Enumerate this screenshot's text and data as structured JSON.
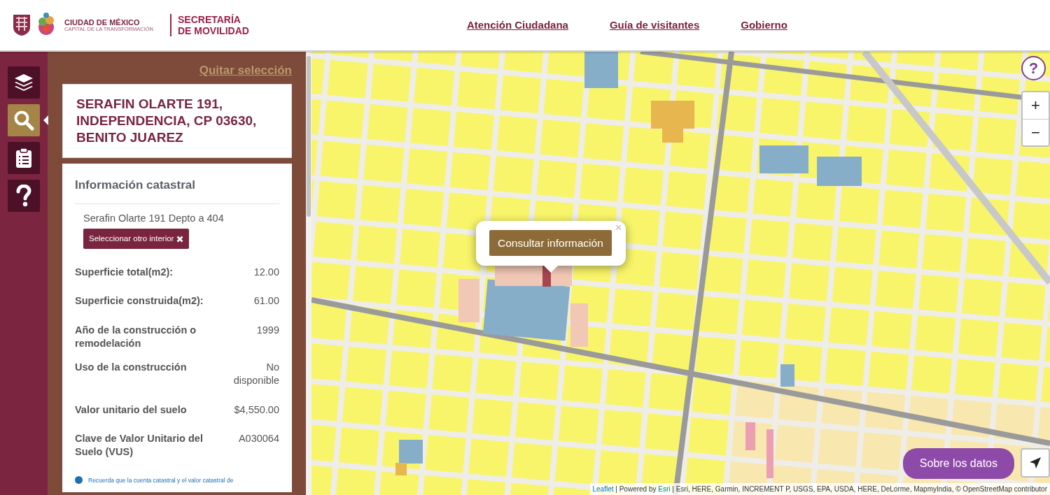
{
  "header": {
    "logo_title": "CIUDAD DE MÉXICO",
    "logo_subtitle": "CAPITAL DE LA TRANSFORMACIÓN",
    "agency_lines": [
      "SECRETARÍA",
      "DE MOVILIDAD"
    ],
    "nav": [
      {
        "label": "Atención Ciudadana"
      },
      {
        "label": "Guía de visitantes"
      },
      {
        "label": "Gobierno"
      }
    ]
  },
  "toolbar": [
    {
      "kind": "layers",
      "selected": false
    },
    {
      "kind": "search",
      "selected": true
    },
    {
      "kind": "clipboard",
      "selected": false
    },
    {
      "kind": "help",
      "selected": false
    }
  ],
  "panel": {
    "clear_link": "Quitar selección",
    "address_lines": [
      "SERAFIN OLARTE 191,",
      "INDEPENDENCIA, CP 03630,",
      "BENITO JUAREZ"
    ],
    "card_title": "Información catastral",
    "interior": "Serafin Olarte 191 Depto a 404",
    "interior_button": "Seleccionar otro interior",
    "rows": [
      {
        "label": "Superficie total(m2):",
        "value": "12.00"
      },
      {
        "label": "Superficie construida(m2):",
        "value": "61.00"
      },
      {
        "label": "Año de la construcción o remodelación",
        "value": "1999"
      },
      {
        "label": "Uso de la construcción",
        "value": "No disponible"
      },
      {
        "label": "Valor unitario del suelo",
        "value": "$4,550.00"
      },
      {
        "label": "Clave de Valor Unitario del Suelo (VUS)",
        "value": "A030064"
      }
    ],
    "note": "Recuerda que la cuenta catastral y el valor catastral de"
  },
  "map": {
    "popup_button": "Consultar información",
    "popup_close": "×",
    "zoom_in": "+",
    "zoom_out": "−",
    "help": "?",
    "about_button": "Sobre los datos",
    "attribution": [
      {
        "kind": "link",
        "text": "Leaflet"
      },
      {
        "kind": "text",
        "text": "| Powered by"
      },
      {
        "kind": "link",
        "text": "Esri"
      },
      {
        "kind": "text",
        "text": "| Esri, HERE, Garmin, INCREMENT P, USGS, EPA, USDA, HERE, DeLorme, MapmyIndia, © OpenStreetMap contributor"
      }
    ]
  }
}
